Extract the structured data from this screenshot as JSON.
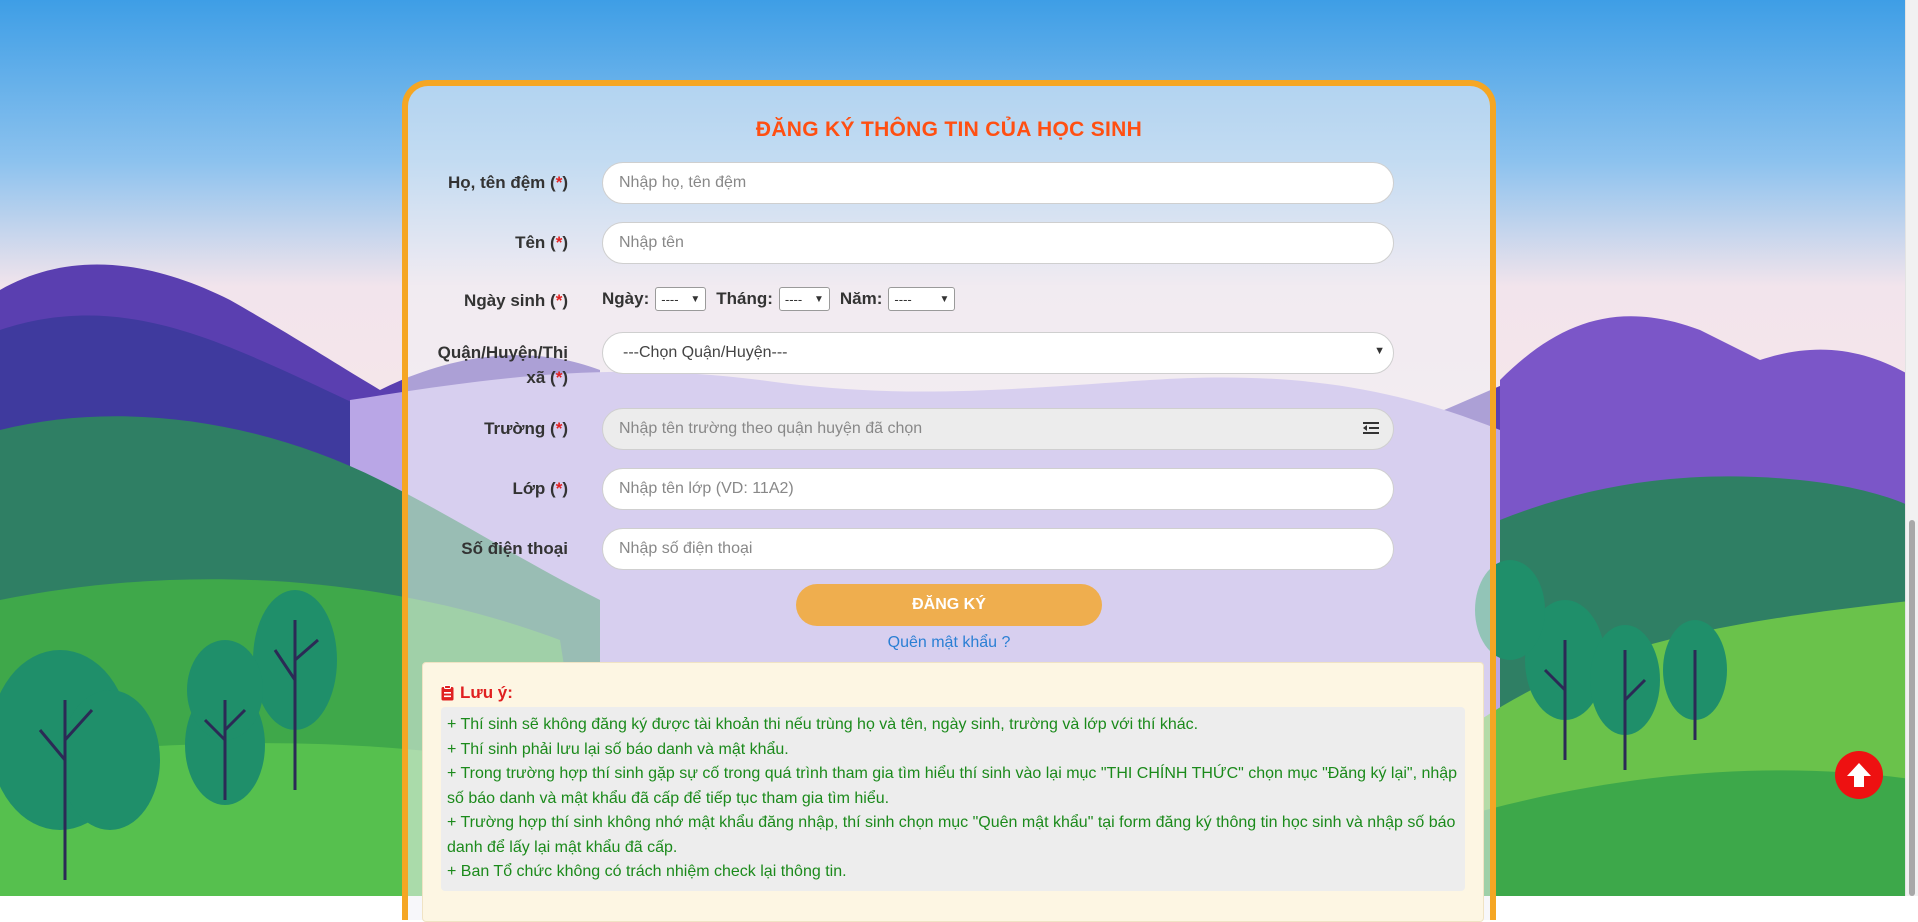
{
  "colors": {
    "accent_orange": "#f5a623",
    "title_red": "#ff4f12",
    "required_red": "#e02020",
    "note_green": "#1b8a1b",
    "link_blue": "#2a7fd4",
    "button_bg": "#efae4e"
  },
  "form": {
    "title": "ĐĂNG KÝ THÔNG TIN CỦA HỌC SINH",
    "required_mark": "(*)",
    "fields": {
      "ho_ten_dem": {
        "label": "Họ, tên đệm",
        "placeholder": "Nhập họ, tên đệm",
        "value": ""
      },
      "ten": {
        "label": "Tên",
        "placeholder": "Nhập tên",
        "value": ""
      },
      "ngay_sinh": {
        "label": "Ngày sinh",
        "day_label": "Ngày:",
        "day_value": "----",
        "month_label": "Tháng:",
        "month_value": "----",
        "year_label": "Năm:",
        "year_value": "----"
      },
      "quan_huyen": {
        "label_line1": "Quận/Huyện/Thị",
        "label_line2": "xã",
        "selected": "---Chọn Quận/Huyện---"
      },
      "truong": {
        "label": "Trường",
        "placeholder": "Nhập tên trường theo quận huyện đã chọn",
        "icon": "list-icon"
      },
      "lop": {
        "label": "Lớp",
        "placeholder": "Nhập tên lớp (VD: 11A2)",
        "value": ""
      },
      "so_dien_thoai": {
        "label": "Số điện thoại",
        "placeholder": "Nhập số điện thoại",
        "value": ""
      }
    },
    "submit_label": "ĐĂNG KÝ",
    "forgot_password": "Quên mật khẩu ?"
  },
  "notes": {
    "title": "Lưu ý:",
    "icon": "clipboard-icon",
    "items": [
      "+ Thí sinh sẽ không đăng ký được tài khoản thi nếu trùng họ và tên, ngày sinh, trường và lớp với thí khác.",
      "+ Thí sinh phải lưu lại số báo danh và mật khẩu.",
      "+ Trong trường hợp thí sinh gặp sự cố trong quá trình tham gia tìm hiểu thí sinh vào lại mục \"THI CHÍNH THỨC\" chọn mục \"Đăng ký lại\", nhập số báo danh và mật khẩu đã cấp để tiếp tục tham gia tìm hiểu.",
      "+ Trường hợp thí sinh không nhớ mật khẩu đăng nhập, thí sinh chọn mục \"Quên mật khẩu\" tại form đăng ký thông tin học sinh và nhập số báo danh để lấy lại mật khẩu đã cấp.",
      "+ Ban Tổ chức không có trách nhiệm check lại thông tin."
    ]
  },
  "back_to_top": {
    "icon": "arrow-up-icon"
  }
}
